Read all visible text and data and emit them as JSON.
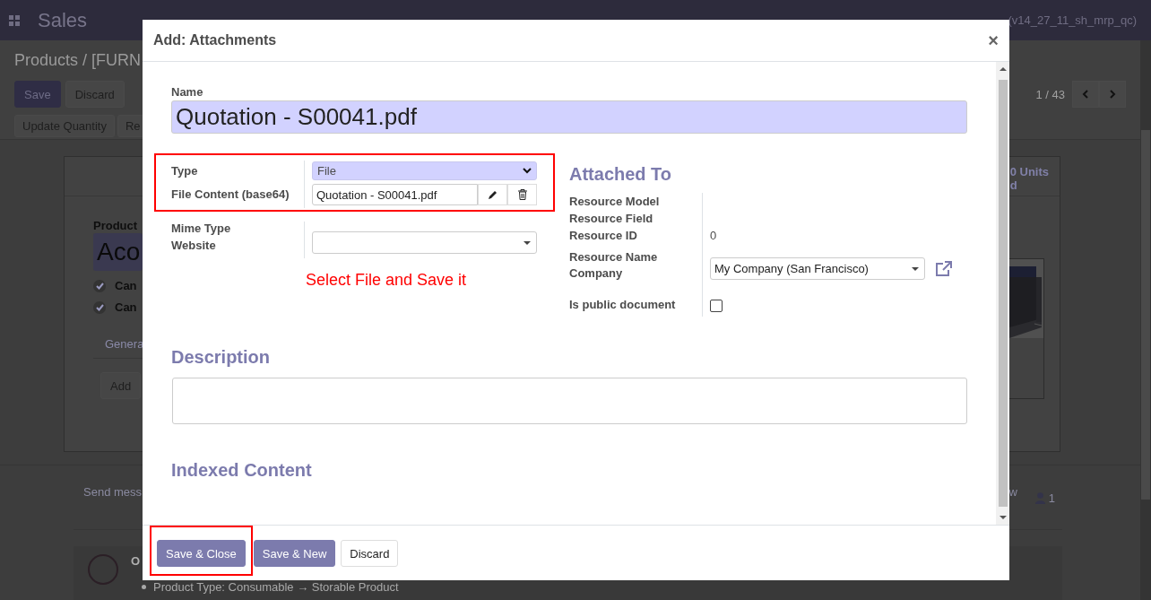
{
  "app": {
    "title": "Sales",
    "user": "(v14_27_11_sh_mrp_qc)"
  },
  "background": {
    "breadcrumb": "Products / [FURN",
    "buttons": [
      "Save",
      "Discard"
    ],
    "pager": "1 / 43",
    "actions": [
      "Update Quantity",
      "Re"
    ],
    "sheet": {
      "stat": "0 Units",
      "stat_2": "d",
      "label": "Product",
      "name": "Aco",
      "checks": [
        {
          "label": "Can",
          "checked": true
        },
        {
          "label": "Can",
          "checked": true
        }
      ],
      "tab": "Genera",
      "add": "Add"
    },
    "chatter": {
      "send": "Send mess",
      "follow": "w",
      "followers": "1",
      "author": "O",
      "change": "Product Type: Consumable → Storable Product"
    }
  },
  "dialog": {
    "title": "Add: Attachments",
    "close": "×",
    "name_label": "Name",
    "name_value": "Quotation - S00041.pdf",
    "left_groups": [
      {
        "highlighted": true,
        "fields": [
          {
            "label": "Type",
            "kind": "select",
            "value": "File"
          },
          {
            "label": "File Content (base64)",
            "kind": "file",
            "value": "Quotation - S00041.pdf"
          }
        ]
      },
      {
        "highlighted": false,
        "fields": [
          {
            "label": "Mime Type",
            "kind": "empty"
          },
          {
            "label": "Website",
            "kind": "dropdown"
          }
        ]
      }
    ],
    "annotation": "Select File and Save it",
    "attached_to": {
      "heading": "Attached To",
      "fields": [
        {
          "label": "Resource Model",
          "kind": "empty"
        },
        {
          "label": "Resource Field",
          "kind": "empty"
        },
        {
          "label": "Resource ID",
          "kind": "text",
          "value": "0"
        },
        {
          "label": "Resource Name",
          "kind": "empty"
        },
        {
          "label": "Company",
          "kind": "dropdown",
          "value": "My Company (San Francisco)",
          "link": true
        },
        {
          "label": "Is public document",
          "kind": "checkbox",
          "checked": false
        }
      ]
    },
    "sections": [
      {
        "heading": "Description",
        "kind": "textarea"
      },
      {
        "heading": "Indexed Content",
        "kind": "none"
      }
    ],
    "buttons": [
      {
        "label": "Save & Close",
        "kind": "primary",
        "highlighted": true
      },
      {
        "label": "Save & New",
        "kind": "primary",
        "highlighted": false
      },
      {
        "label": "Discard",
        "kind": "secondary",
        "highlighted": false
      }
    ]
  }
}
